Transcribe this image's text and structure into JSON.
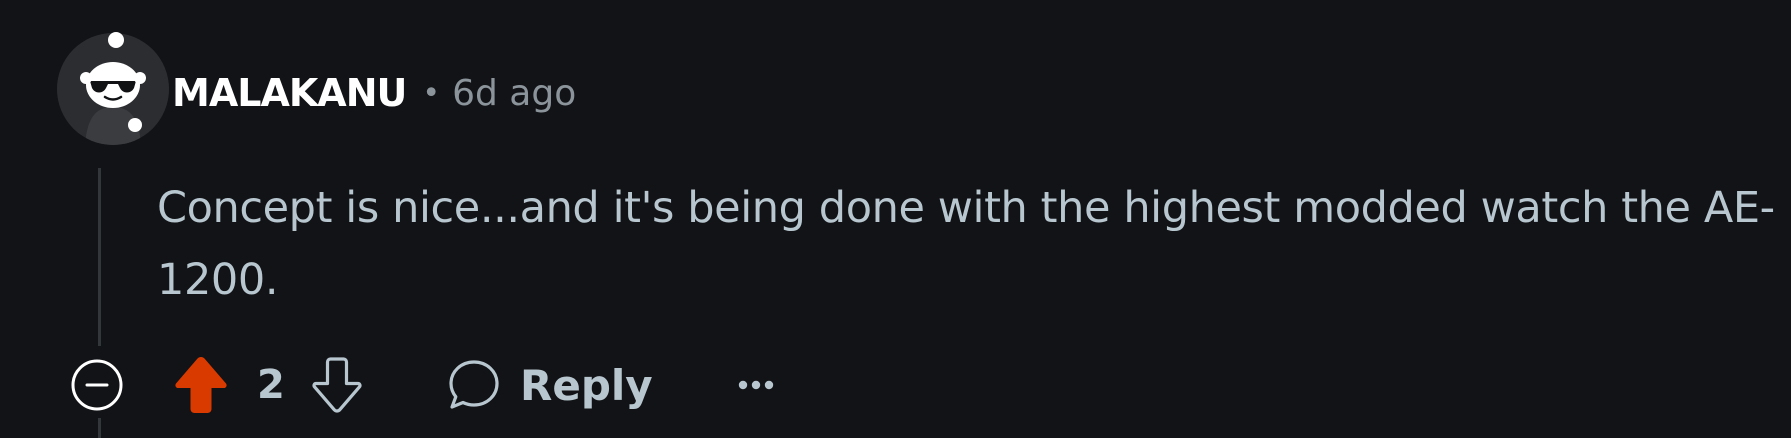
{
  "comment": {
    "author": "MALAKANU",
    "separator": "•",
    "timestamp": "6d ago",
    "body": "Concept is nice...and it's being done with the highest modded watch the AE-1200.",
    "vote_count": "2",
    "reply_label": "Reply",
    "more_label": "•••"
  },
  "icons": {
    "collapse": "minus-circle-icon",
    "upvote": "upvote-arrow-icon",
    "downvote": "downvote-arrow-icon",
    "reply": "speech-bubble-icon",
    "more": "ellipsis-icon",
    "avatar": "snoo-avatar"
  },
  "colors": {
    "background": "#121316",
    "upvote_active": "#d93a00",
    "text_primary": "#ffffff",
    "text_secondary": "#b7c6cf",
    "meta": "#8b949b"
  }
}
